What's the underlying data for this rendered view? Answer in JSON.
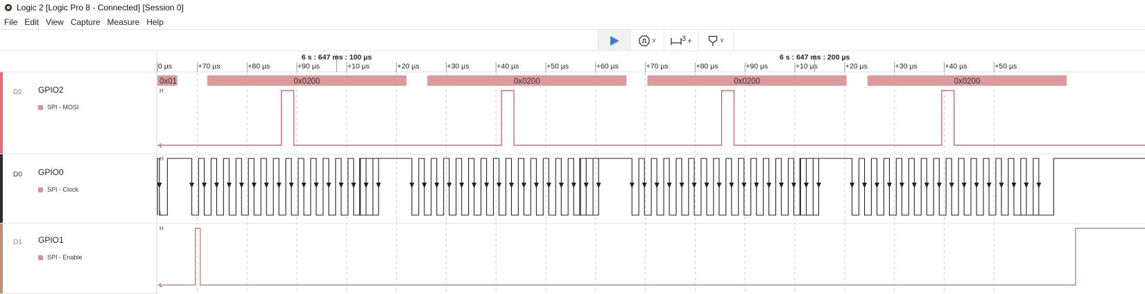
{
  "window": {
    "title": "Logic 2 [Logic Pro 8 - Connected] [Session 0]"
  },
  "menu": [
    "File",
    "Edit",
    "View",
    "Capture",
    "Measure",
    "Help"
  ],
  "toolbar": {
    "play_icon": "play-icon",
    "trigger_icon": "trigger-icon",
    "timing_icon": "timing-marker-icon",
    "timing_count": "3",
    "timing_plus": "+",
    "measure_icon": "measurement-pin-icon",
    "accent": "#3b82c4"
  },
  "ruler": {
    "ticks": [
      "0 µs",
      "+70 µs",
      "+80 µs",
      "+90 µs",
      "+10 µs",
      "+20 µs",
      "+30 µs",
      "+40 µs",
      "+50 µs",
      "+60 µs",
      "+70 µs",
      "+80 µs",
      "+90 µs",
      "+10 µs",
      "+20 µs",
      "+30 µs",
      "+40 µs",
      "+50 µs"
    ],
    "anchors": [
      "6 s : 647 ms : 100 µs",
      "6 s : 647 ms : 200 µs"
    ]
  },
  "channels": [
    {
      "id": "D2",
      "name": "GPIO2",
      "analyzer": "SPI - MOSI",
      "color": "#e06c78"
    },
    {
      "id": "D0",
      "name": "GPIO0",
      "analyzer": "SPI - Clock",
      "color": "#2b2b2b"
    },
    {
      "id": "D1",
      "name": "GPIO1",
      "analyzer": "SPI - Enable",
      "color": "#b8937a"
    }
  ],
  "decoded_mosi": [
    "0x01",
    "0x0200",
    "0x0200",
    "0x0200",
    "0x0200"
  ],
  "level_labels": {
    "high": "H",
    "low": "L"
  },
  "colors": {
    "decode_fill": "#dc9a9d",
    "mosi_wave": "#c2525f",
    "enable_wave": "#a8786a",
    "clock_wave": "#222222",
    "grid": "#d0d0d0"
  }
}
